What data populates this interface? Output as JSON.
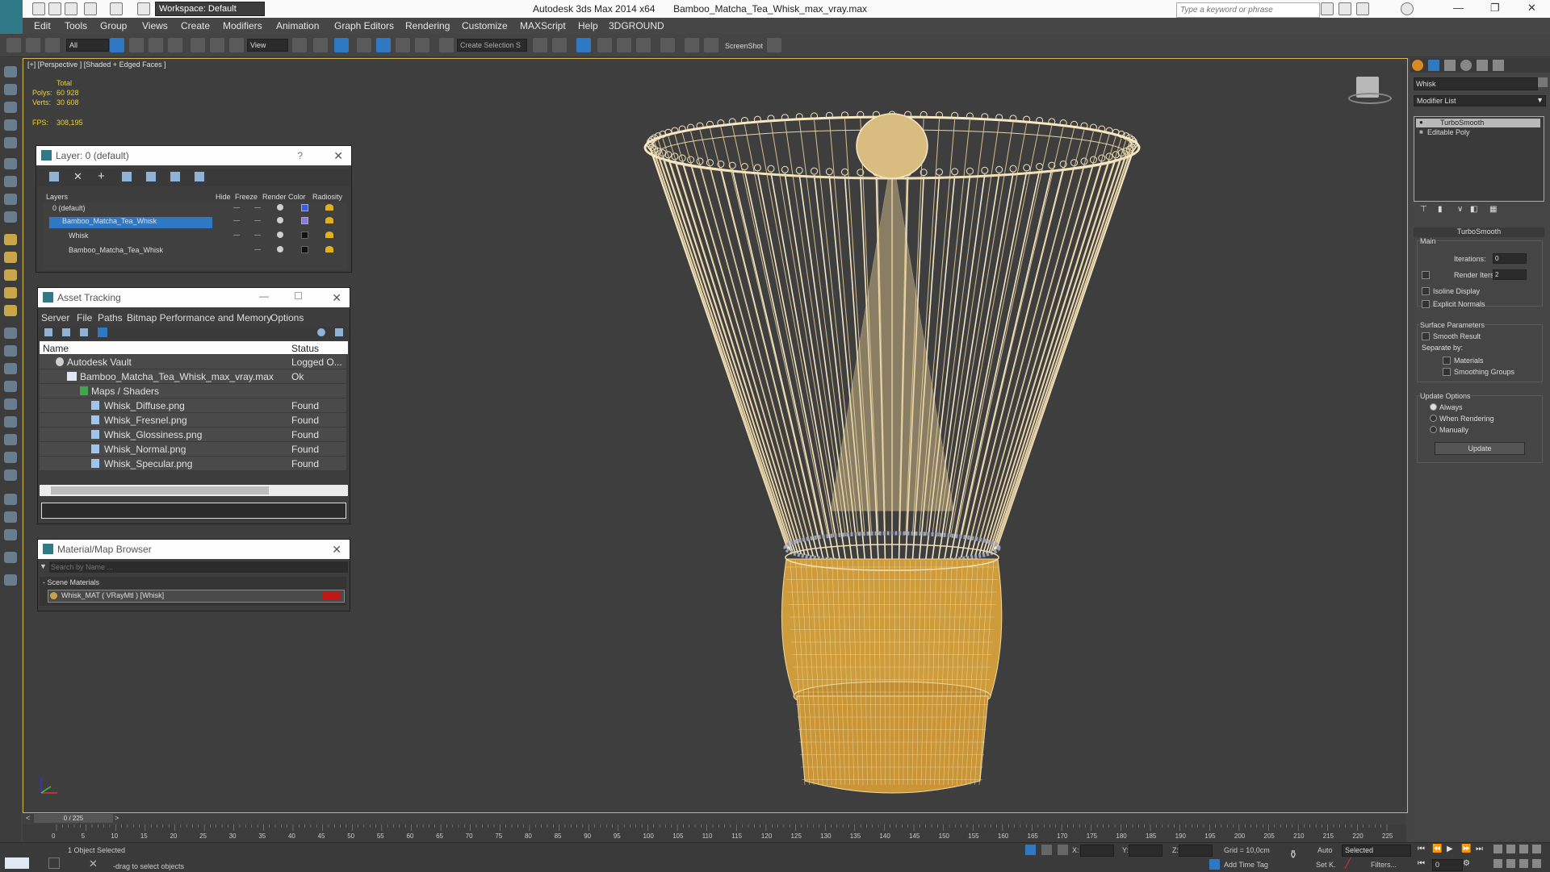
{
  "window": {
    "app_title": "Autodesk 3ds Max  2014 x64",
    "file_title": "Bamboo_Matcha_Tea_Whisk_max_vray.max",
    "workspace": "Workspace: Default",
    "search_placeholder": "Type a keyword or phrase"
  },
  "menu": [
    "Edit",
    "Tools",
    "Group",
    "Views",
    "Create",
    "Modifiers",
    "Animation",
    "Graph Editors",
    "Rendering",
    "Customize",
    "MAXScript",
    "Help",
    "3DGROUND"
  ],
  "toolbar": {
    "selection_filter": "All",
    "ref_coord": "View",
    "named_selection": "Create Selection S",
    "screenshot_label": "ScreenShot"
  },
  "viewport": {
    "label": "[+] [Perspective ] [Shaded + Edged Faces ]",
    "stats": {
      "total_label": "Total",
      "polys_label": "Polys:",
      "polys_value": "60 928",
      "verts_label": "Verts:",
      "verts_value": "30 608",
      "fps_label": "FPS:",
      "fps_value": "308,195"
    }
  },
  "layer_panel": {
    "title": "Layer: 0 (default)",
    "help": "?",
    "columns": [
      "Layers",
      "Hide",
      "Freeze",
      "Render",
      "Color",
      "Radiosity"
    ],
    "rows": [
      {
        "name": "0 (default)",
        "color": "#3a5ed8"
      },
      {
        "name": "Bamboo_Matcha_Tea_Whisk",
        "color": "#8a7ad8"
      },
      {
        "name": "Whisk",
        "color": "#111111"
      },
      {
        "name": "Bamboo_Matcha_Tea_Whisk",
        "color": "#111111"
      }
    ]
  },
  "asset_tracking": {
    "title": "Asset Tracking",
    "menu": [
      "Server",
      "File",
      "Paths",
      "Bitmap Performance and Memory",
      "Options"
    ],
    "columns": [
      "Name",
      "Status"
    ],
    "rows": [
      {
        "name": "Autodesk Vault",
        "status": "Logged O..."
      },
      {
        "name": "Bamboo_Matcha_Tea_Whisk_max_vray.max",
        "status": "Ok"
      },
      {
        "name": "Maps / Shaders",
        "status": ""
      },
      {
        "name": "Whisk_Diffuse.png",
        "status": "Found"
      },
      {
        "name": "Whisk_Fresnel.png",
        "status": "Found"
      },
      {
        "name": "Whisk_Glossiness.png",
        "status": "Found"
      },
      {
        "name": "Whisk_Normal.png",
        "status": "Found"
      },
      {
        "name": "Whisk_Specular.png",
        "status": "Found"
      }
    ]
  },
  "material_browser": {
    "title": "Material/Map Browser",
    "search_placeholder": "Search by Name ...",
    "section": "- Scene Materials",
    "material": "Whisk_MAT  ( VRayMtl )  [Whisk]",
    "swatch_color": "#c01818"
  },
  "command_panel": {
    "object_name": "Whisk",
    "modifier_list": "Modifier List",
    "stack": [
      "TurboSmooth",
      "Editable Poly"
    ],
    "rollout_title": "TurboSmooth",
    "main_label": "Main",
    "iterations_label": "Iterations:",
    "iterations_value": "0",
    "render_iters_label": "Render Iters:",
    "render_iters_value": "2",
    "isoline_label": "Isoline Display",
    "explicit_normals_label": "Explicit Normals",
    "surface_params_label": "Surface Parameters",
    "smooth_result_label": "Smooth Result",
    "separate_by_label": "Separate by:",
    "materials_label": "Materials",
    "smoothing_groups_label": "Smoothing Groups",
    "update_options_label": "Update Options",
    "always_label": "Always",
    "when_rendering_label": "When Rendering",
    "manually_label": "Manually",
    "update_button": "Update"
  },
  "timeline": {
    "frame_label": "0 / 225",
    "ticks": [
      "0",
      "5",
      "10",
      "15",
      "20",
      "25",
      "30",
      "35",
      "40",
      "45",
      "50",
      "55",
      "60",
      "65",
      "70",
      "75",
      "80",
      "85",
      "90",
      "95",
      "100",
      "105",
      "110",
      "115",
      "120",
      "125",
      "130",
      "135",
      "140",
      "145",
      "150",
      "155",
      "160",
      "165",
      "170",
      "175",
      "180",
      "185",
      "190",
      "195",
      "200",
      "205",
      "210",
      "215",
      "220",
      "225"
    ]
  },
  "status": {
    "selection": "1 Object Selected",
    "prompt": "-drag to select objects",
    "x_label": "X:",
    "y_label": "Y:",
    "z_label": "Z:",
    "grid": "Grid = 10,0cm",
    "add_time_tag": "Add Time Tag",
    "auto": "Auto",
    "set_key": "Set K.",
    "key_mode": "Selected",
    "filters": "Filters...",
    "frame_value": "0"
  },
  "colors": {
    "accent": "#2f78c4",
    "viewport_border": "#d4b64e",
    "stats": "#e8d430",
    "wire": "#f5e6c4",
    "bamboo": "#d9a94a"
  }
}
